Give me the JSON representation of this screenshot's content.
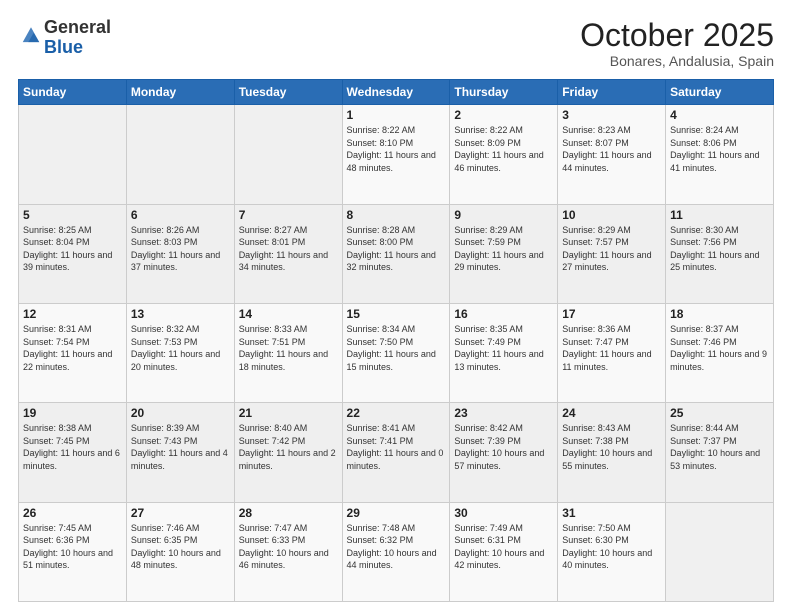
{
  "header": {
    "logo_general": "General",
    "logo_blue": "Blue",
    "title": "October 2025",
    "location": "Bonares, Andalusia, Spain"
  },
  "days_of_week": [
    "Sunday",
    "Monday",
    "Tuesday",
    "Wednesday",
    "Thursday",
    "Friday",
    "Saturday"
  ],
  "weeks": [
    [
      {
        "day": "",
        "info": ""
      },
      {
        "day": "",
        "info": ""
      },
      {
        "day": "",
        "info": ""
      },
      {
        "day": "1",
        "info": "Sunrise: 8:22 AM\nSunset: 8:10 PM\nDaylight: 11 hours and 48 minutes."
      },
      {
        "day": "2",
        "info": "Sunrise: 8:22 AM\nSunset: 8:09 PM\nDaylight: 11 hours and 46 minutes."
      },
      {
        "day": "3",
        "info": "Sunrise: 8:23 AM\nSunset: 8:07 PM\nDaylight: 11 hours and 44 minutes."
      },
      {
        "day": "4",
        "info": "Sunrise: 8:24 AM\nSunset: 8:06 PM\nDaylight: 11 hours and 41 minutes."
      }
    ],
    [
      {
        "day": "5",
        "info": "Sunrise: 8:25 AM\nSunset: 8:04 PM\nDaylight: 11 hours and 39 minutes."
      },
      {
        "day": "6",
        "info": "Sunrise: 8:26 AM\nSunset: 8:03 PM\nDaylight: 11 hours and 37 minutes."
      },
      {
        "day": "7",
        "info": "Sunrise: 8:27 AM\nSunset: 8:01 PM\nDaylight: 11 hours and 34 minutes."
      },
      {
        "day": "8",
        "info": "Sunrise: 8:28 AM\nSunset: 8:00 PM\nDaylight: 11 hours and 32 minutes."
      },
      {
        "day": "9",
        "info": "Sunrise: 8:29 AM\nSunset: 7:59 PM\nDaylight: 11 hours and 29 minutes."
      },
      {
        "day": "10",
        "info": "Sunrise: 8:29 AM\nSunset: 7:57 PM\nDaylight: 11 hours and 27 minutes."
      },
      {
        "day": "11",
        "info": "Sunrise: 8:30 AM\nSunset: 7:56 PM\nDaylight: 11 hours and 25 minutes."
      }
    ],
    [
      {
        "day": "12",
        "info": "Sunrise: 8:31 AM\nSunset: 7:54 PM\nDaylight: 11 hours and 22 minutes."
      },
      {
        "day": "13",
        "info": "Sunrise: 8:32 AM\nSunset: 7:53 PM\nDaylight: 11 hours and 20 minutes."
      },
      {
        "day": "14",
        "info": "Sunrise: 8:33 AM\nSunset: 7:51 PM\nDaylight: 11 hours and 18 minutes."
      },
      {
        "day": "15",
        "info": "Sunrise: 8:34 AM\nSunset: 7:50 PM\nDaylight: 11 hours and 15 minutes."
      },
      {
        "day": "16",
        "info": "Sunrise: 8:35 AM\nSunset: 7:49 PM\nDaylight: 11 hours and 13 minutes."
      },
      {
        "day": "17",
        "info": "Sunrise: 8:36 AM\nSunset: 7:47 PM\nDaylight: 11 hours and 11 minutes."
      },
      {
        "day": "18",
        "info": "Sunrise: 8:37 AM\nSunset: 7:46 PM\nDaylight: 11 hours and 9 minutes."
      }
    ],
    [
      {
        "day": "19",
        "info": "Sunrise: 8:38 AM\nSunset: 7:45 PM\nDaylight: 11 hours and 6 minutes."
      },
      {
        "day": "20",
        "info": "Sunrise: 8:39 AM\nSunset: 7:43 PM\nDaylight: 11 hours and 4 minutes."
      },
      {
        "day": "21",
        "info": "Sunrise: 8:40 AM\nSunset: 7:42 PM\nDaylight: 11 hours and 2 minutes."
      },
      {
        "day": "22",
        "info": "Sunrise: 8:41 AM\nSunset: 7:41 PM\nDaylight: 11 hours and 0 minutes."
      },
      {
        "day": "23",
        "info": "Sunrise: 8:42 AM\nSunset: 7:39 PM\nDaylight: 10 hours and 57 minutes."
      },
      {
        "day": "24",
        "info": "Sunrise: 8:43 AM\nSunset: 7:38 PM\nDaylight: 10 hours and 55 minutes."
      },
      {
        "day": "25",
        "info": "Sunrise: 8:44 AM\nSunset: 7:37 PM\nDaylight: 10 hours and 53 minutes."
      }
    ],
    [
      {
        "day": "26",
        "info": "Sunrise: 7:45 AM\nSunset: 6:36 PM\nDaylight: 10 hours and 51 minutes."
      },
      {
        "day": "27",
        "info": "Sunrise: 7:46 AM\nSunset: 6:35 PM\nDaylight: 10 hours and 48 minutes."
      },
      {
        "day": "28",
        "info": "Sunrise: 7:47 AM\nSunset: 6:33 PM\nDaylight: 10 hours and 46 minutes."
      },
      {
        "day": "29",
        "info": "Sunrise: 7:48 AM\nSunset: 6:32 PM\nDaylight: 10 hours and 44 minutes."
      },
      {
        "day": "30",
        "info": "Sunrise: 7:49 AM\nSunset: 6:31 PM\nDaylight: 10 hours and 42 minutes."
      },
      {
        "day": "31",
        "info": "Sunrise: 7:50 AM\nSunset: 6:30 PM\nDaylight: 10 hours and 40 minutes."
      },
      {
        "day": "",
        "info": ""
      }
    ]
  ]
}
